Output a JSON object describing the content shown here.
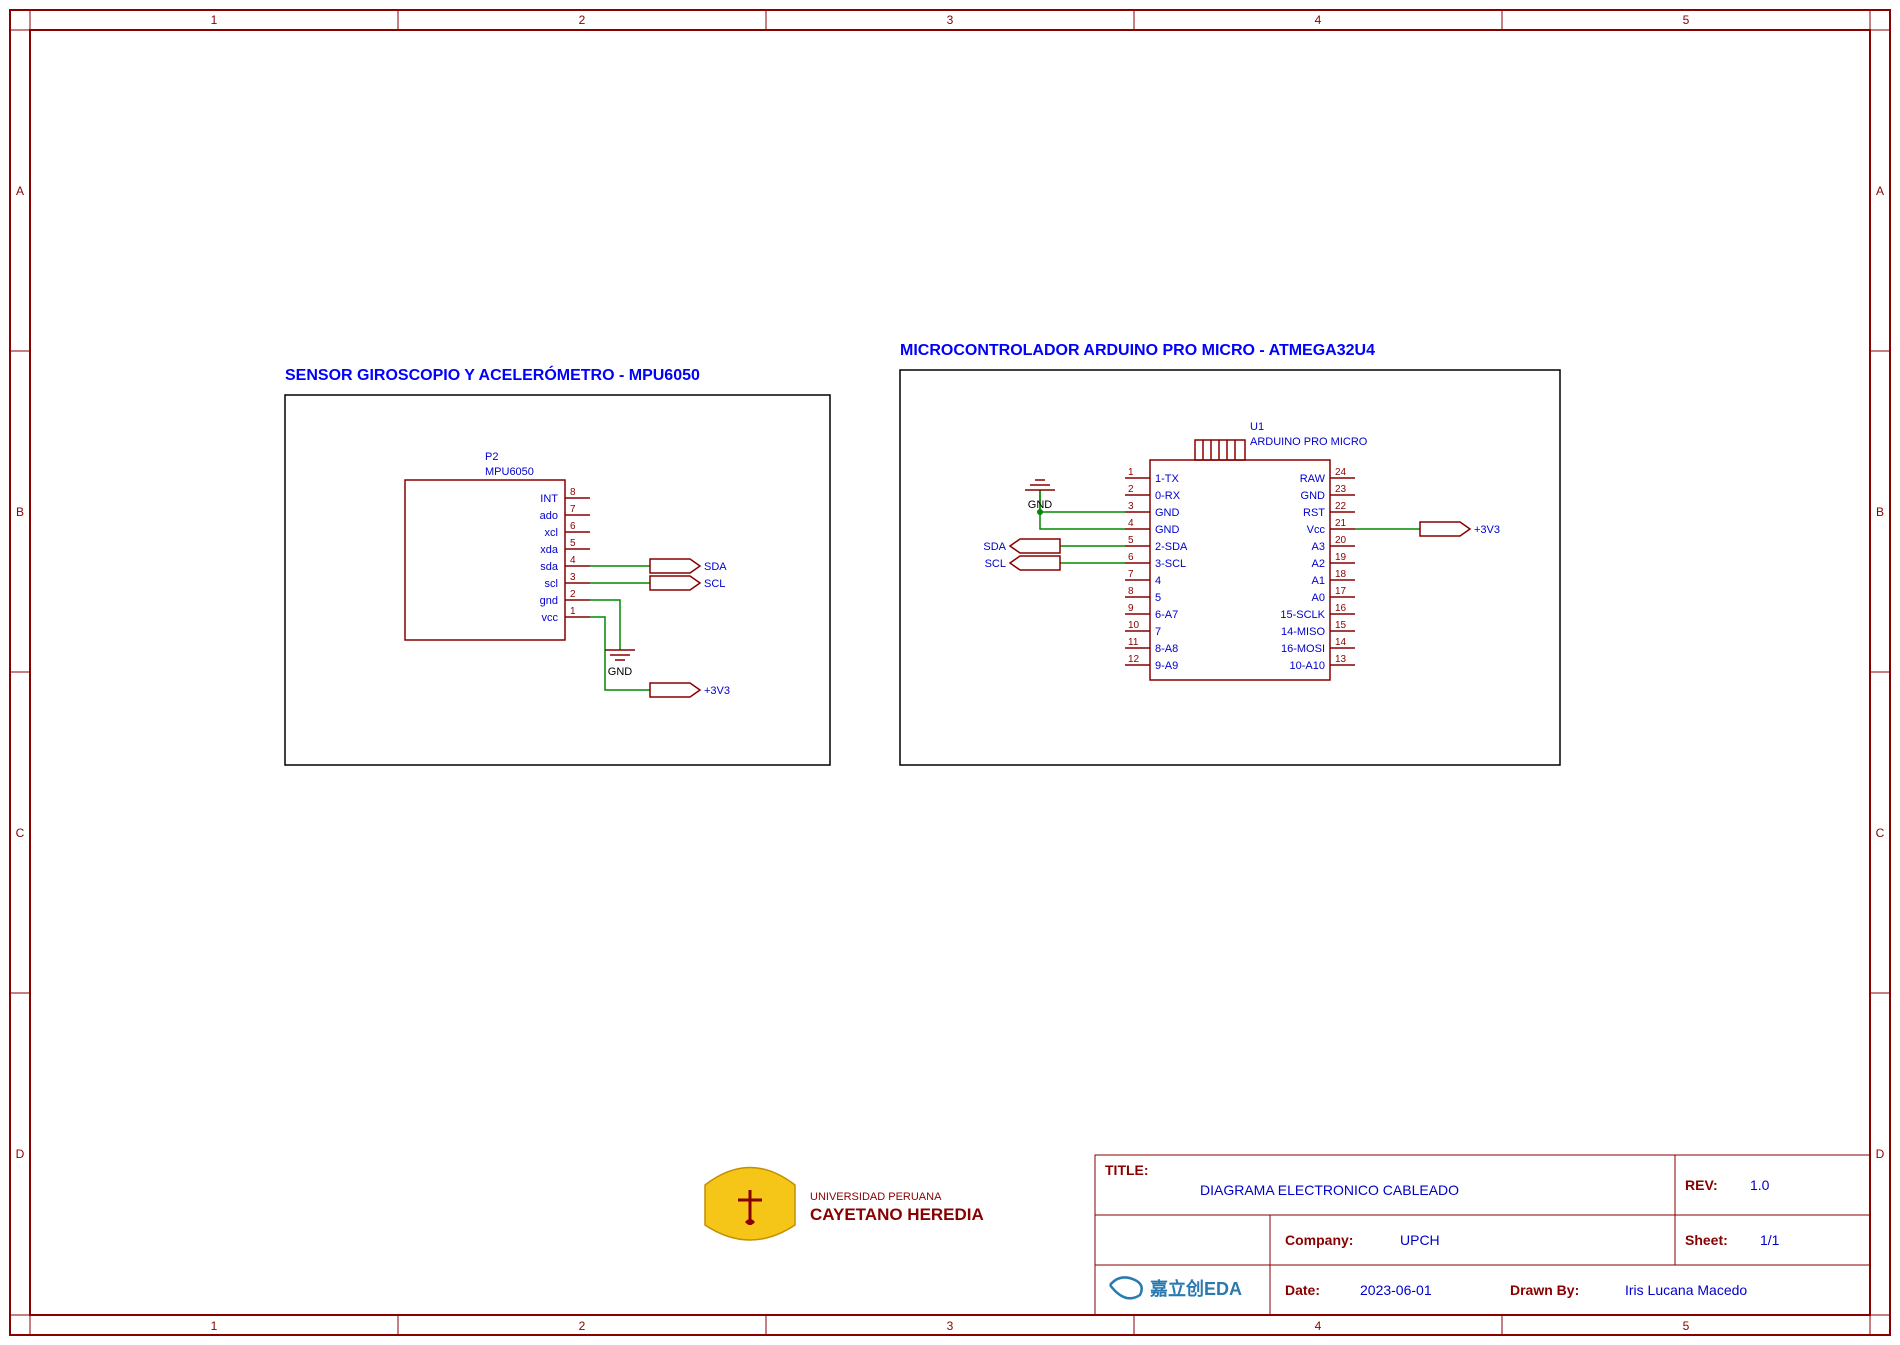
{
  "frame": {
    "cols": [
      "1",
      "2",
      "3",
      "4",
      "5"
    ],
    "rows": [
      "A",
      "B",
      "C",
      "D"
    ]
  },
  "blocks": {
    "sensor": {
      "title": "SENSOR GIROSCOPIO Y ACELERÓMETRO - MPU6050",
      "ref": "P2",
      "part": "MPU6050",
      "pins": [
        {
          "n": "8",
          "name": "INT"
        },
        {
          "n": "7",
          "name": "ado"
        },
        {
          "n": "6",
          "name": "xcl"
        },
        {
          "n": "5",
          "name": "xda"
        },
        {
          "n": "4",
          "name": "sda"
        },
        {
          "n": "3",
          "name": "scl"
        },
        {
          "n": "2",
          "name": "gnd"
        },
        {
          "n": "1",
          "name": "vcc"
        }
      ],
      "nets": {
        "sda": "SDA",
        "scl": "SCL",
        "gnd": "GND",
        "v33": "+3V3"
      }
    },
    "mcu": {
      "title": "MICROCONTROLADOR ARDUINO PRO MICRO - ATMEGA32U4",
      "ref": "U1",
      "part": "ARDUINO PRO MICRO",
      "left_pins": [
        {
          "n": "1",
          "name": "1-TX"
        },
        {
          "n": "2",
          "name": "0-RX"
        },
        {
          "n": "3",
          "name": "GND"
        },
        {
          "n": "4",
          "name": "GND"
        },
        {
          "n": "5",
          "name": "2-SDA"
        },
        {
          "n": "6",
          "name": "3-SCL"
        },
        {
          "n": "7",
          "name": "4"
        },
        {
          "n": "8",
          "name": "5"
        },
        {
          "n": "9",
          "name": "6-A7"
        },
        {
          "n": "10",
          "name": "7"
        },
        {
          "n": "11",
          "name": "8-A8"
        },
        {
          "n": "12",
          "name": "9-A9"
        }
      ],
      "right_pins": [
        {
          "n": "24",
          "name": "RAW"
        },
        {
          "n": "23",
          "name": "GND"
        },
        {
          "n": "22",
          "name": "RST"
        },
        {
          "n": "21",
          "name": "Vcc"
        },
        {
          "n": "20",
          "name": "A3"
        },
        {
          "n": "19",
          "name": "A2"
        },
        {
          "n": "18",
          "name": "A1"
        },
        {
          "n": "17",
          "name": "A0"
        },
        {
          "n": "16",
          "name": "15-SCLK"
        },
        {
          "n": "15",
          "name": "14-MISO"
        },
        {
          "n": "14",
          "name": "16-MOSI"
        },
        {
          "n": "13",
          "name": "10-A10"
        }
      ],
      "nets": {
        "gnd": "GND",
        "sda": "SDA",
        "scl": "SCL",
        "v33": "+3V3"
      }
    }
  },
  "titleblock": {
    "title_label": "TITLE:",
    "title": "DIAGRAMA ELECTRONICO CABLEADO",
    "rev_label": "REV:",
    "rev": "1.0",
    "company_label": "Company:",
    "company": "UPCH",
    "sheet_label": "Sheet:",
    "sheet": "1/1",
    "date_label": "Date:",
    "date": "2023-06-01",
    "drawn_label": "Drawn By:",
    "drawn": "Iris Lucana Macedo",
    "eda": "嘉立创EDA"
  },
  "logo": {
    "line1": "UNIVERSIDAD PERUANA",
    "line2": "CAYETANO HEREDIA"
  }
}
